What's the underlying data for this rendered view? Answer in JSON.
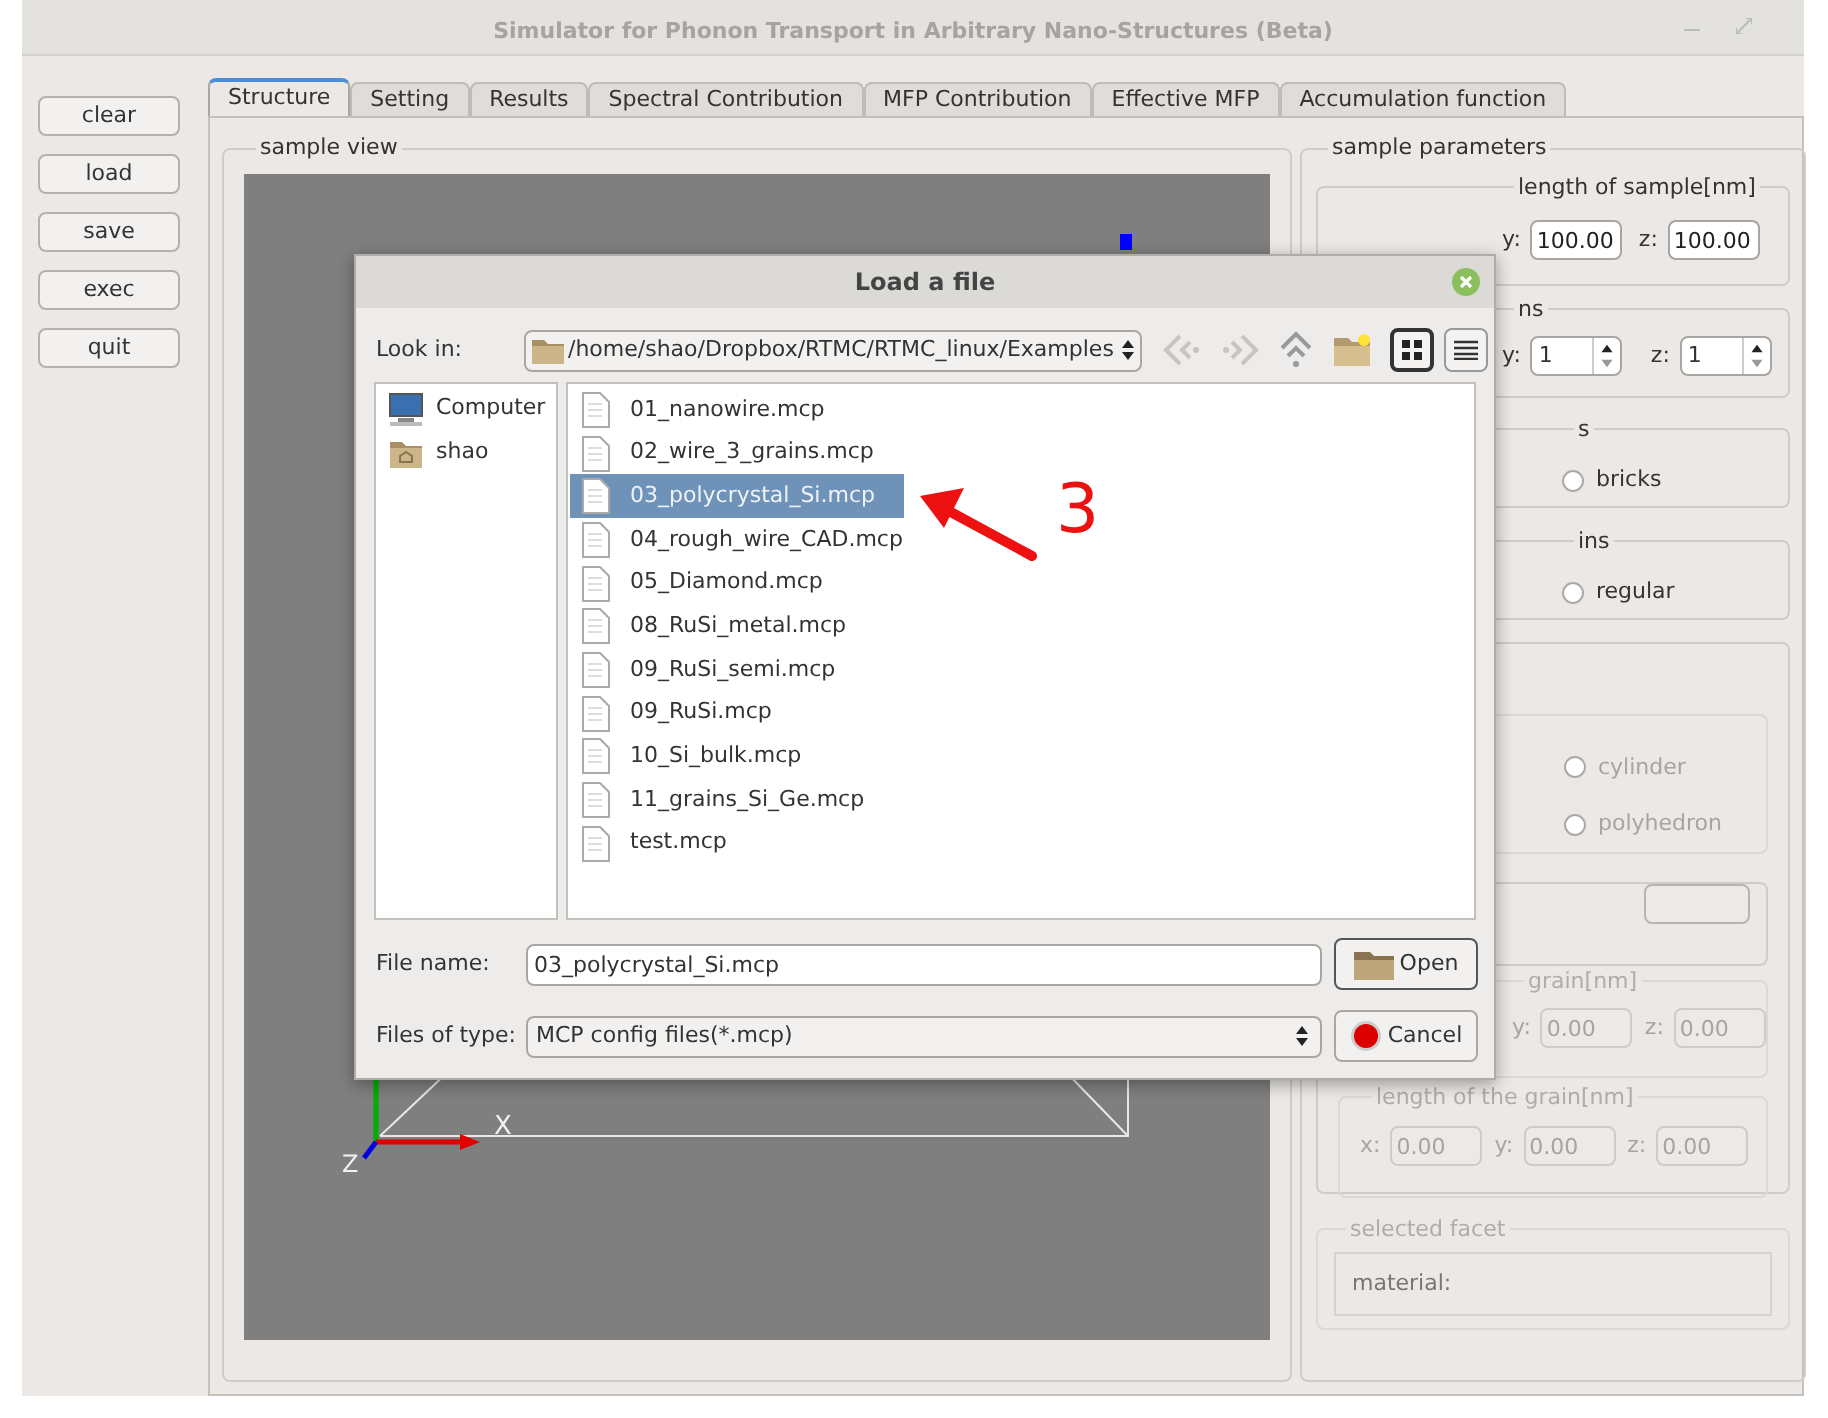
{
  "window": {
    "title": "Simulator for Phonon Transport in Arbitrary Nano-Structures (Beta)"
  },
  "side_buttons": [
    "clear",
    "load",
    "save",
    "exec",
    "quit"
  ],
  "tabs": [
    {
      "label": "Structure",
      "selected": true
    },
    {
      "label": "Setting",
      "selected": false
    },
    {
      "label": "Results",
      "selected": false
    },
    {
      "label": "Spectral Contribution",
      "selected": false
    },
    {
      "label": "MFP Contribution",
      "selected": false
    },
    {
      "label": "Effective MFP",
      "selected": false
    },
    {
      "label": "Accumulation function",
      "selected": false
    }
  ],
  "sample_view": {
    "title": "sample view",
    "legend": [
      {
        "color": "#0000ff"
      }
    ],
    "axis_labels": [
      "X",
      "Z"
    ]
  },
  "sample_parameters": {
    "title": "sample parameters",
    "length_group": {
      "title": "length of sample[nm]",
      "fields": [
        {
          "label": "y:",
          "value": "100.00"
        },
        {
          "label": "z:",
          "value": "100.00"
        }
      ]
    },
    "divisions_group": {
      "title": "ns",
      "fields": [
        {
          "label": "y:",
          "value": "1"
        },
        {
          "label": "z:",
          "value": "1"
        }
      ]
    },
    "shape_group": {
      "title": "s",
      "options": [
        {
          "label": "bricks",
          "selected": false
        }
      ]
    },
    "grains_group": {
      "title": "ins",
      "options": [
        {
          "label": "regular",
          "selected": false
        }
      ]
    },
    "grain_options": {
      "disabled": true,
      "options": [
        {
          "label": "cylinder",
          "selected": false
        },
        {
          "label": "polyhedron",
          "selected": false
        }
      ]
    },
    "grain_group": {
      "title": "grain[nm]",
      "disabled": true,
      "fields": [
        {
          "label": "y:",
          "value": "0.00"
        },
        {
          "label": "z:",
          "value": "0.00"
        }
      ]
    },
    "grain_length_group": {
      "title": "length of the grain[nm]",
      "disabled": true,
      "fields": [
        {
          "label": "x:",
          "value": "0.00"
        },
        {
          "label": "y:",
          "value": "0.00"
        },
        {
          "label": "z:",
          "value": "0.00"
        }
      ]
    },
    "selected_facet": {
      "title": "selected facet",
      "material_label": "material:"
    }
  },
  "dialog": {
    "title": "Load a file",
    "look_in_label": "Look in:",
    "path": "/home/shao/Dropbox/RTMC/RTMC_linux/Examples",
    "nav": [
      {
        "kind": "back",
        "disabled": true
      },
      {
        "kind": "forward",
        "disabled": true
      },
      {
        "kind": "up",
        "disabled": false
      },
      {
        "kind": "new-folder",
        "disabled": false
      }
    ],
    "view_modes": [
      {
        "kind": "icons",
        "selected": true
      },
      {
        "kind": "list",
        "selected": false
      }
    ],
    "places": [
      {
        "label": "Computer",
        "kind": "computer"
      },
      {
        "label": "shao",
        "kind": "home"
      }
    ],
    "files": [
      {
        "name": "01_nanowire.mcp",
        "selected": false
      },
      {
        "name": "02_wire_3_grains.mcp",
        "selected": false
      },
      {
        "name": "03_polycrystal_Si.mcp",
        "selected": true
      },
      {
        "name": "04_rough_wire_CAD.mcp",
        "selected": false
      },
      {
        "name": "05_Diamond.mcp",
        "selected": false
      },
      {
        "name": "08_RuSi_metal.mcp",
        "selected": false
      },
      {
        "name": "09_RuSi_semi.mcp",
        "selected": false
      },
      {
        "name": "09_RuSi.mcp",
        "selected": false
      },
      {
        "name": "10_Si_bulk.mcp",
        "selected": false
      },
      {
        "name": "11_grains_Si_Ge.mcp",
        "selected": false
      },
      {
        "name": "test.mcp",
        "selected": false
      }
    ],
    "file_name_label": "File name:",
    "file_name": "03_polycrystal_Si.mcp",
    "file_type_label": "Files of type:",
    "file_type": "MCP config files(*.mcp)",
    "open_button": "Open",
    "cancel_button": "Cancel"
  },
  "annotation": {
    "label": "3"
  }
}
